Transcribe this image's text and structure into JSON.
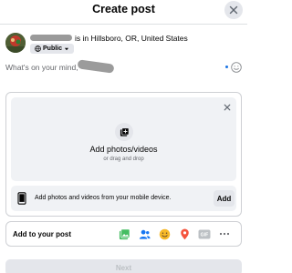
{
  "header": {
    "title": "Create post",
    "close_icon": "close-icon"
  },
  "user": {
    "location_text": "is in Hillsboro, OR, United States",
    "audience_label": "Public",
    "audience_icon": "globe-icon",
    "audience_caret_icon": "caret-down-icon"
  },
  "composer": {
    "placeholder": "What's on your mind,",
    "emoji_icon": "smiley-icon"
  },
  "upload": {
    "title": "Add photos/videos",
    "subtitle": "or drag and drop",
    "photo_icon": "add-photo-icon",
    "close_icon": "close-icon"
  },
  "mobile": {
    "text": "Add photos and videos from your mobile device.",
    "button_label": "Add",
    "icon": "mobile-device-icon"
  },
  "add_to_post": {
    "label": "Add to your post",
    "tools": [
      {
        "name": "photo-video-icon",
        "color": "#45bd62"
      },
      {
        "name": "tag-people-icon",
        "color": "#1877f2"
      },
      {
        "name": "feeling-activity-icon",
        "color": "#f7b928"
      },
      {
        "name": "check-in-icon",
        "color": "#f5533d"
      },
      {
        "name": "gif-icon",
        "color": "#bcc0c4"
      },
      {
        "name": "more-options-icon",
        "color": "#65676b"
      }
    ],
    "gif_label": "GIF"
  },
  "footer": {
    "next_label": "Next"
  },
  "colors": {
    "accent": "#1b74e4",
    "surface": "#f0f2f5",
    "button_gray": "#e4e6eb",
    "border": "#ced0d4"
  }
}
